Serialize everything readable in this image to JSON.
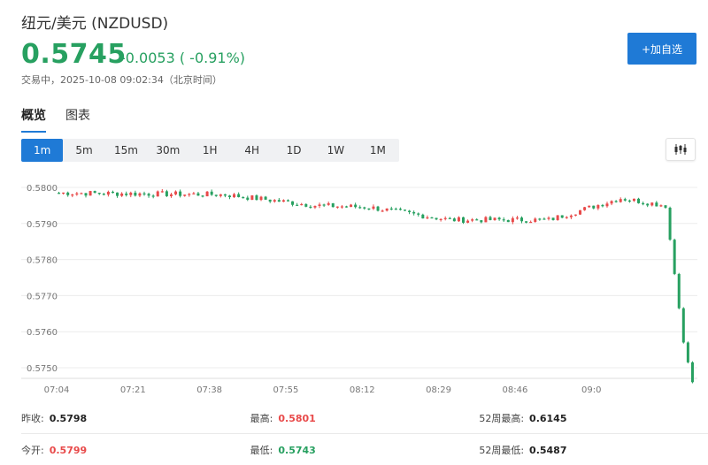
{
  "header": {
    "title": "纽元/美元 (NZDUSD)",
    "price": "0.5745",
    "change": "-0.0053 ( -0.91%)",
    "status": "交易中，2025-10-08 09:02:34（北京时间）",
    "add_label": "+加自选"
  },
  "tabs": [
    {
      "label": "概览",
      "active": true
    },
    {
      "label": "图表",
      "active": false
    }
  ],
  "intervals": [
    "1m",
    "5m",
    "15m",
    "30m",
    "1H",
    "4H",
    "1D",
    "1W",
    "1M"
  ],
  "active_interval": "1m",
  "icons": {
    "chart_type": "candlestick-icon"
  },
  "colors": {
    "up": "#e84a4a",
    "down": "#27a060",
    "accent": "#1f7ad6"
  },
  "stats": [
    [
      {
        "label": "昨收:",
        "value": "0.5798",
        "tone": "neutral"
      },
      {
        "label": "最高:",
        "value": "0.5801",
        "tone": "up"
      },
      {
        "label": "52周最高:",
        "value": "0.6145",
        "tone": "neutral"
      }
    ],
    [
      {
        "label": "今开:",
        "value": "0.5799",
        "tone": "up"
      },
      {
        "label": "最低:",
        "value": "0.5743",
        "tone": "down"
      },
      {
        "label": "52周最低:",
        "value": "0.5487",
        "tone": "neutral"
      }
    ]
  ],
  "chart_data": {
    "type": "candlestick",
    "title": "",
    "xlabel": "",
    "ylabel": "",
    "ylim": [
      0.5745,
      0.5801
    ],
    "y_ticks": [
      "0.5800",
      "0.5790",
      "0.5780",
      "0.5770",
      "0.5760",
      "0.5750"
    ],
    "y_tick_values": [
      0.58,
      0.579,
      0.578,
      0.577,
      0.576,
      0.575
    ],
    "x_ticks": [
      "07:04",
      "07:21",
      "07:38",
      "07:55",
      "08:12",
      "08:29",
      "08:46",
      "09:0"
    ],
    "grid": true,
    "segments": [
      {
        "minutes": 38,
        "start": 0.57985,
        "end": 0.5798
      },
      {
        "minutes": 20,
        "start": 0.5798,
        "end": 0.5795
      },
      {
        "minutes": 12,
        "start": 0.5795,
        "end": 0.57945
      },
      {
        "minutes": 18,
        "start": 0.57945,
        "end": 0.5791
      },
      {
        "minutes": 22,
        "start": 0.5791,
        "end": 0.5791
      },
      {
        "minutes": 16,
        "start": 0.5791,
        "end": 0.5797
      },
      {
        "minutes": 10,
        "start": 0.5797,
        "end": 0.5795
      },
      {
        "minutes": 4,
        "start": 0.5795,
        "end": 0.5757
      },
      {
        "minutes": 2,
        "start": 0.5757,
        "end": 0.5746
      }
    ]
  }
}
